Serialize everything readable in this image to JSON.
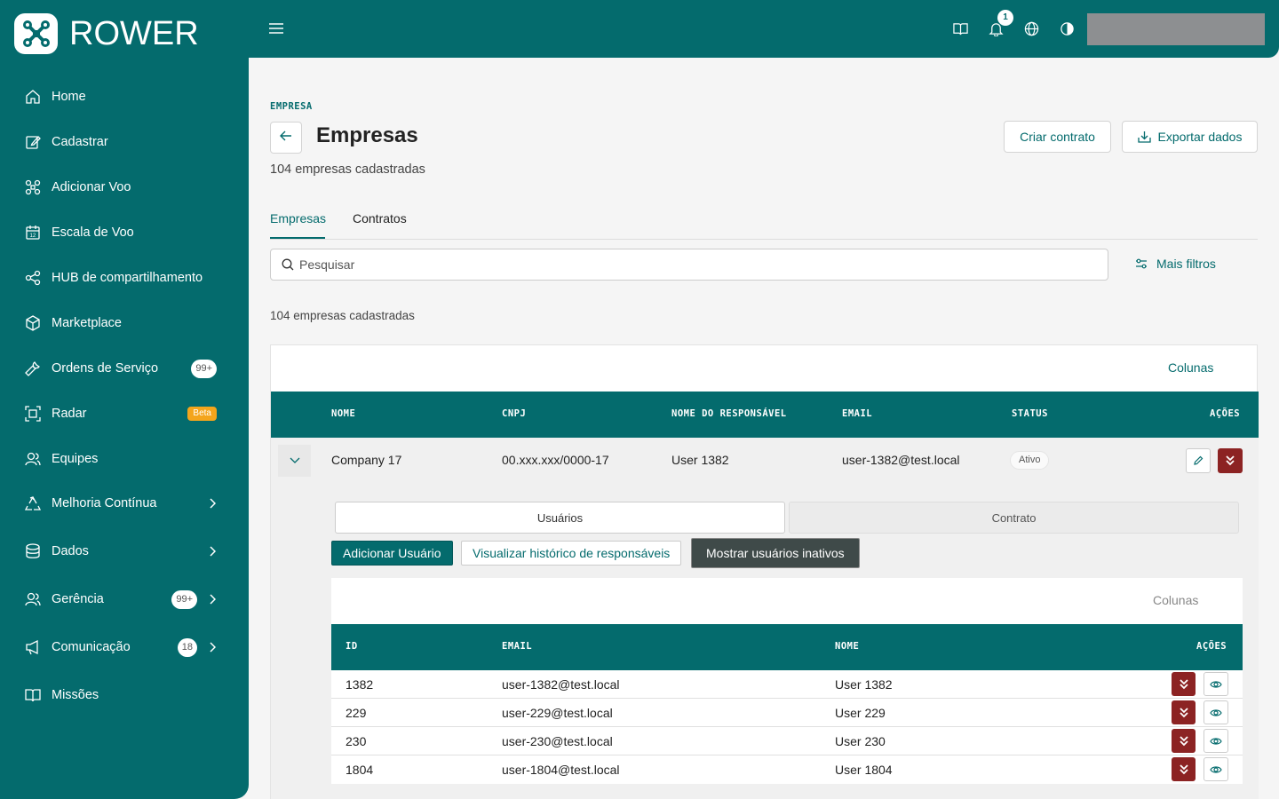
{
  "app": {
    "logo_text": "ROWER"
  },
  "sidebar": {
    "items": [
      {
        "label": "Home",
        "icon": "home-icon"
      },
      {
        "label": "Cadastrar",
        "icon": "edit-icon"
      },
      {
        "label": "Adicionar Voo",
        "icon": "drone-icon"
      },
      {
        "label": "Escala de Voo",
        "icon": "calendar-icon"
      },
      {
        "label": "HUB de compartilhamento",
        "icon": "share-icon"
      },
      {
        "label": "Marketplace",
        "icon": "box-icon"
      },
      {
        "label": "Ordens de Serviço",
        "icon": "wrench-icon",
        "badge": "99+"
      },
      {
        "label": "Radar",
        "icon": "radar-icon",
        "badge": "Beta"
      },
      {
        "label": "Equipes",
        "icon": "users-icon"
      },
      {
        "label": "Melhoria Contínua",
        "icon": "recycle-icon"
      },
      {
        "label": "Dados",
        "icon": "database-icon"
      },
      {
        "label": "Gerência",
        "icon": "users-icon",
        "badge": "99+"
      },
      {
        "label": "Comunicação",
        "icon": "megaphone-icon",
        "badge": "18"
      },
      {
        "label": "Missões",
        "icon": "book-icon"
      }
    ]
  },
  "topbar": {
    "notification_count": "1"
  },
  "page": {
    "breadcrumb": "EMPRESA",
    "title": "Empresas",
    "subtitle": "104 empresas cadastradas",
    "create_contract": "Criar contrato",
    "export": "Exportar dados",
    "tabs": [
      "Empresas",
      "Contratos"
    ],
    "search_placeholder": "Pesquisar",
    "more_filters": "Mais filtros",
    "count": "104 empresas cadastradas",
    "columns_link": "Colunas"
  },
  "table": {
    "headers": [
      "NOME",
      "CNPJ",
      "NOME DO RESPONSÁVEL",
      "EMAIL",
      "STATUS",
      "AÇÕES"
    ],
    "rows": [
      {
        "nome": "Company 17",
        "cnpj": "00.xxx.xxx/0000-17",
        "responsavel": "User 1382",
        "email": "user-1382@test.local",
        "status": "Ativo"
      }
    ]
  },
  "expanded": {
    "subtabs": [
      "Usuários",
      "Contrato"
    ],
    "add_user": "Adicionar Usuário",
    "history": "Visualizar histórico de responsáveis",
    "show_inactive": "Mostrar usuários inativos",
    "columns_link": "Colunas",
    "headers": [
      "ID",
      "EMAIL",
      "NOME",
      "AÇÕES"
    ],
    "rows": [
      {
        "id": "1382",
        "email": "user-1382@test.local",
        "nome": "User 1382"
      },
      {
        "id": "229",
        "email": "user-229@test.local",
        "nome": "User 229"
      },
      {
        "id": "230",
        "email": "user-230@test.local",
        "nome": "User 230"
      },
      {
        "id": "1804",
        "email": "user-1804@test.local",
        "nome": "User 1804"
      }
    ]
  },
  "colors": {
    "brand": "#046b6d",
    "danger": "#8c2323",
    "beta": "#f4a51c"
  }
}
